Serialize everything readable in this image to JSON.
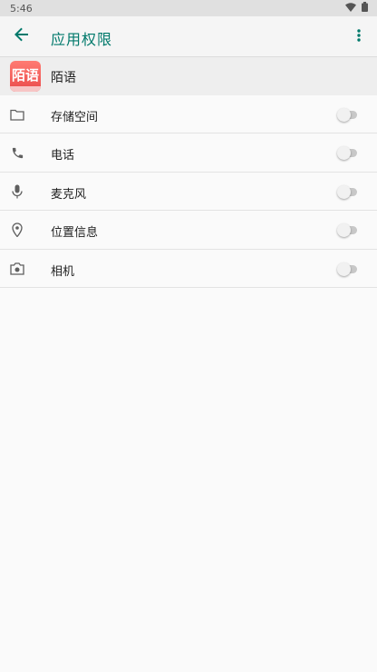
{
  "status_bar": {
    "time": "5:46",
    "icons": [
      "wifi-icon",
      "battery-icon"
    ]
  },
  "app_bar": {
    "back_icon": "arrow-left-icon",
    "title": "应用权限",
    "overflow_icon": "more-vert-icon"
  },
  "app": {
    "name": "陌语",
    "icon_text": "陌语"
  },
  "permissions": [
    {
      "icon": "folder-icon",
      "label": "存储空间",
      "enabled": false
    },
    {
      "icon": "phone-icon",
      "label": "电话",
      "enabled": false
    },
    {
      "icon": "microphone-icon",
      "label": "麦克风",
      "enabled": false
    },
    {
      "icon": "location-icon",
      "label": "位置信息",
      "enabled": false
    },
    {
      "icon": "camera-icon",
      "label": "相机",
      "enabled": false
    }
  ],
  "colors": {
    "accent": "#00796b",
    "app_bar": "#f5f5f5",
    "header": "#eeeeee",
    "background": "#fafafa"
  }
}
